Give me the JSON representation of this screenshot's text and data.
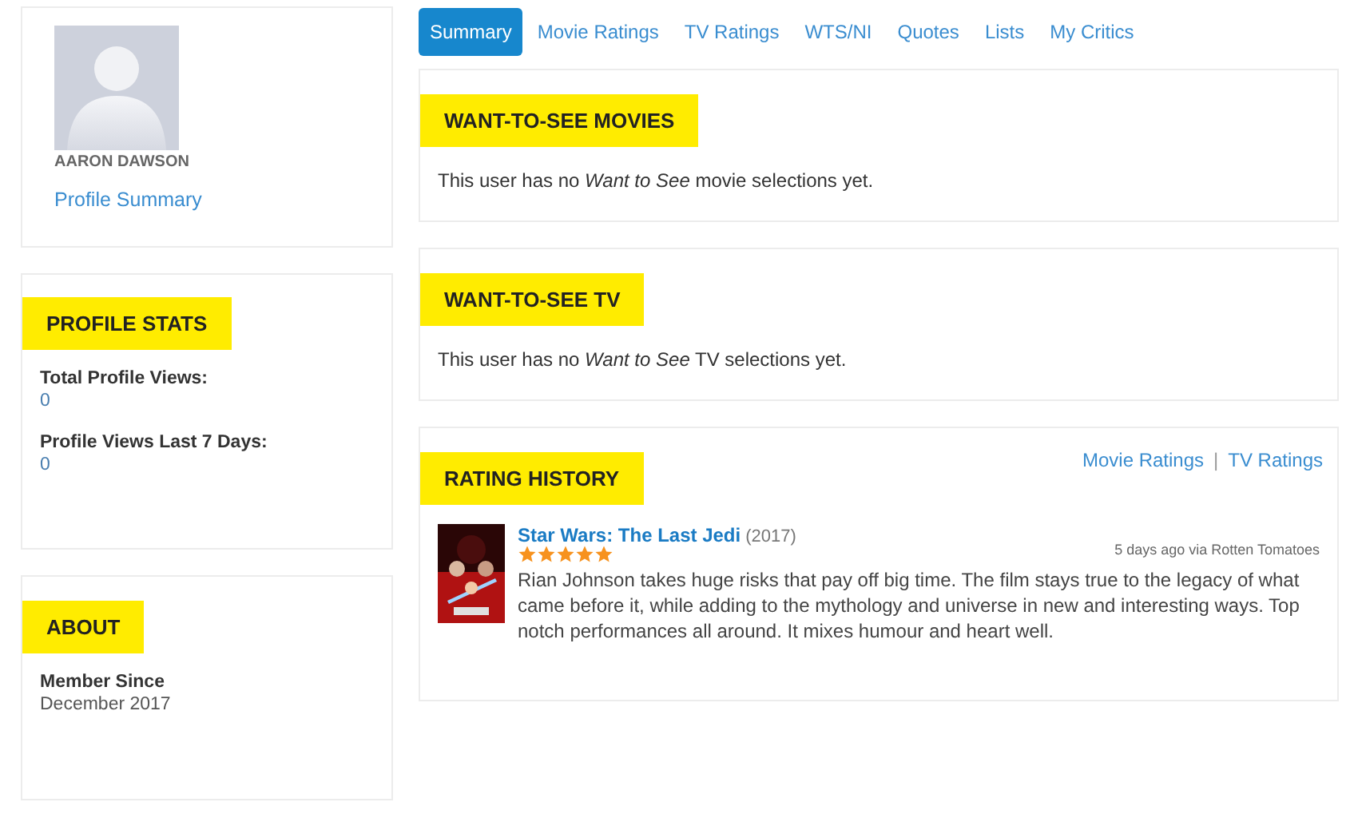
{
  "profile": {
    "name": "AARON DAWSON",
    "link": "Profile Summary"
  },
  "profile_stats": {
    "heading": "PROFILE STATS",
    "stats": [
      {
        "label": "Total Profile Views:",
        "value": "0"
      },
      {
        "label": "Profile Views Last 7 Days:",
        "value": "0"
      }
    ]
  },
  "about": {
    "heading": "ABOUT",
    "label": "Member Since",
    "value": "December 2017"
  },
  "tabs": [
    {
      "label": "Summary",
      "selected": true
    },
    {
      "label": "Movie Ratings",
      "selected": false
    },
    {
      "label": "TV Ratings",
      "selected": false
    },
    {
      "label": "WTS/NI",
      "selected": false
    },
    {
      "label": "Quotes",
      "selected": false
    },
    {
      "label": "Lists",
      "selected": false
    },
    {
      "label": "My Critics",
      "selected": false
    }
  ],
  "sections": [
    {
      "heading": "WANT-TO-SEE MOVIES",
      "message": "This user has no *Want to See* movie selections yet."
    },
    {
      "heading": "WANT-TO-SEE TV",
      "message": "This user has no *Want to See* TV selections yet."
    }
  ],
  "rating_history": {
    "heading": "RATING HISTORY",
    "links": [
      "Movie Ratings",
      "TV Ratings"
    ],
    "separator": "|",
    "ratings": [
      {
        "title": "Star Wars: The Last Jedi",
        "year": "(2017)",
        "stars": 5,
        "meta": "5 days ago via Rotten Tomatoes",
        "review": "Rian Johnson takes huge risks that pay off big time. The film stays true to the legacy of what came before it, while adding to the mythology and universe in new and interesting ways. Top notch performances all around. It mixes humour and heart well."
      }
    ]
  }
}
